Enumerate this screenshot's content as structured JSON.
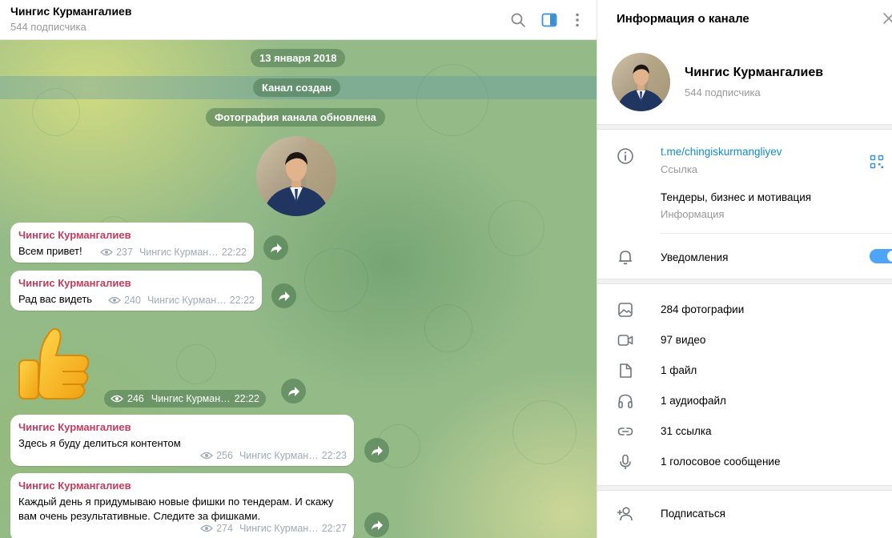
{
  "chat_header": {
    "title": "Чингис Курмангалиев",
    "subtitle": "544 подписчика"
  },
  "service_messages": {
    "date": "13 января 2018",
    "created": "Канал создан",
    "photo_updated": "Фотография канала обновлена"
  },
  "messages": [
    {
      "author": "Чингис Курмангалиев",
      "text": "Всем привет!",
      "views": "237",
      "signature": "Чингис Курман…",
      "time": "22:22"
    },
    {
      "author": "Чингис Курмангалиев",
      "text": "Рад вас видеть",
      "views": "240",
      "signature": "Чингис Курман…",
      "time": "22:22"
    },
    {
      "sticker": "thumbs-up",
      "views": "246",
      "signature": "Чингис Курман…",
      "time": "22:22"
    },
    {
      "author": "Чингис Курмангалиев",
      "text": "Здесь я буду делиться контентом",
      "views": "256",
      "signature": "Чингис Курман…",
      "time": "22:23"
    },
    {
      "author": "Чингис Курмангалиев",
      "text_line1": "Каждый день я придумываю новые фишки по тендерам. И скажу",
      "text_line2": "вам очень результативные. Следите за фишками.",
      "views": "274",
      "signature": "Чингис Курман…",
      "time": "22:27"
    }
  ],
  "panel": {
    "title": "Информация о канале",
    "name": "Чингис Курмангалиев",
    "subscribers": "544 подписчика",
    "link": "t.me/chingiskurmangliyev",
    "link_label": "Ссылка",
    "description": "Тендеры, бизнес и мотивация",
    "description_label": "Информация",
    "notifications": "Уведомления",
    "notifications_on": true,
    "media": {
      "photos": "284 фотографии",
      "videos": "97 видео",
      "files": "1 файл",
      "audio": "1 аудиофайл",
      "links": "31 ссылка",
      "voice": "1 голосовое сообщение"
    },
    "subscribe": "Подписаться"
  },
  "colors": {
    "accent": "#168acd",
    "author": "#c03d5d",
    "toggle": "#4ea4f6",
    "chat_bg": "#94ba88"
  }
}
